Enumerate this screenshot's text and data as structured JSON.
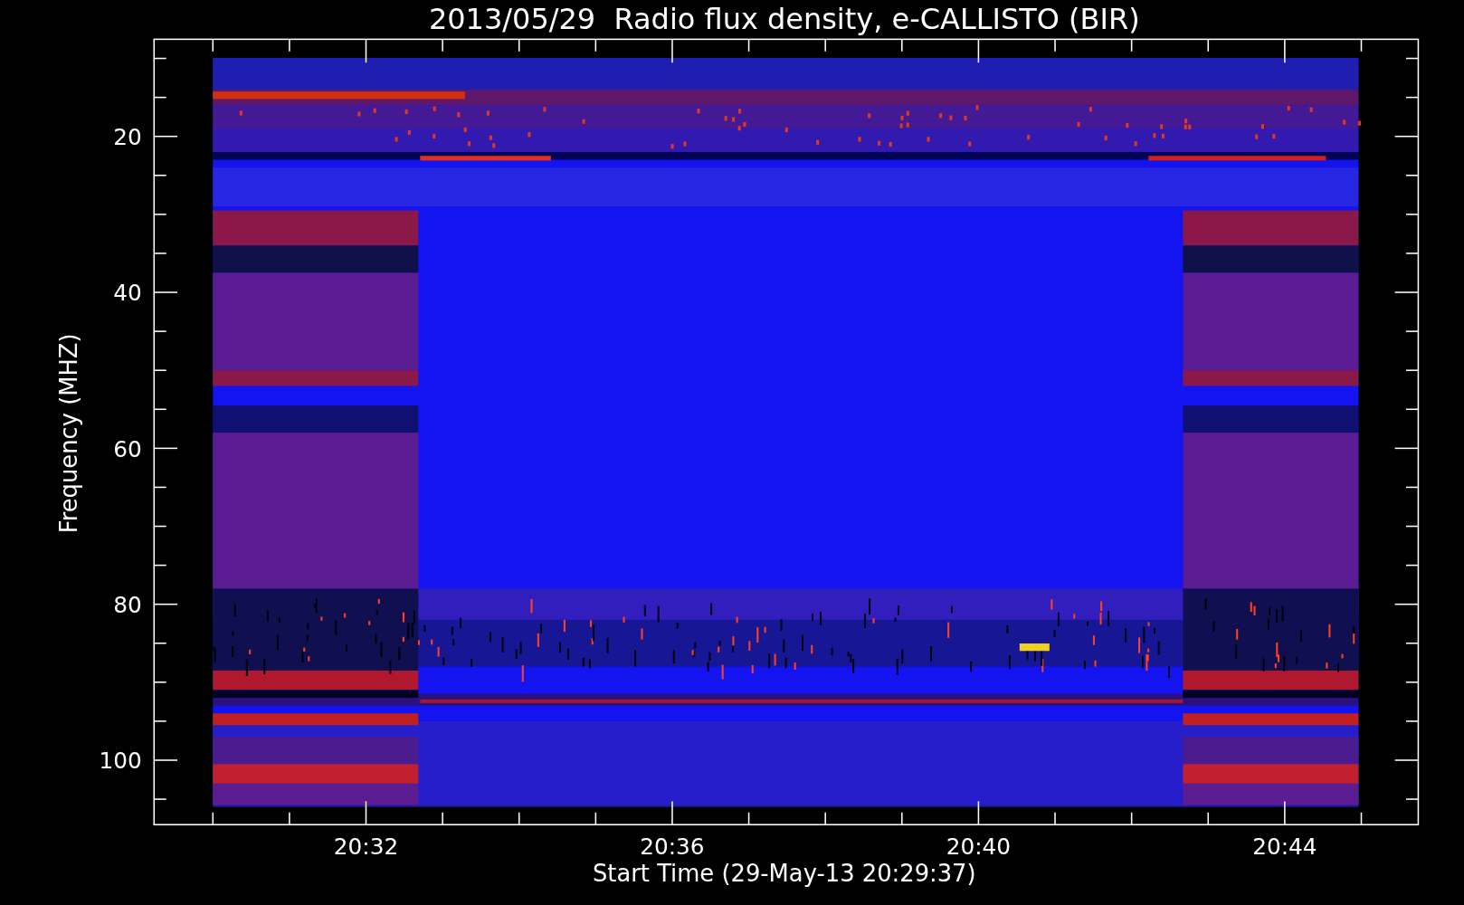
{
  "chart": {
    "title": "2013/05/29  Radio flux density, e-CALLISTO (BIR)",
    "ylabel": "Frequency (MHZ)",
    "xlabel": "Start Time (29-May-13 20:29:37)",
    "yticks": [
      "20",
      "40",
      "60",
      "80",
      "100"
    ],
    "xticks": [
      "20:32",
      "20:36",
      "20:40",
      "20:44"
    ]
  }
}
